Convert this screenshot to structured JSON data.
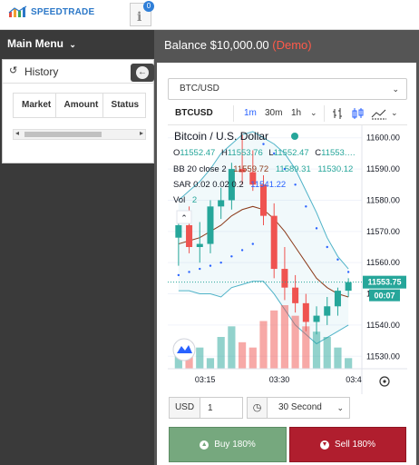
{
  "brand": {
    "name": "SPEEDTRADE"
  },
  "notifications": {
    "count": "0",
    "icon": "info-icon"
  },
  "sidebar": {
    "main_menu_label": "Main Menu",
    "history": {
      "title": "History",
      "columns": [
        "Market",
        "Amount",
        "Status"
      ]
    }
  },
  "account": {
    "balance_text": "Balance $10,000.00",
    "mode_text": "(Demo)"
  },
  "market_select": {
    "value": "BTC/USD"
  },
  "chart_toolbar": {
    "symbol": "BTCUSD",
    "timeframes": [
      "1m",
      "30m",
      "1h"
    ],
    "active_timeframe": "1m"
  },
  "chart_data": {
    "type": "candlestick",
    "title": "Bitcoin / U.S. Dollar",
    "ohlc_legend": {
      "o_label": "O",
      "o": "11552.47",
      "h_label": "H",
      "h": "11553.76",
      "l_label": "L",
      "l": "11552.47",
      "c_label": "C",
      "c": "11553.…"
    },
    "bb_legend": {
      "label": "BB 20 close 2",
      "basis": "11559.72",
      "upper": "11589.31",
      "lower": "11530.12"
    },
    "sar_legend": {
      "label": "SAR 0.02 0.02 0.2",
      "value": "11541.22"
    },
    "vol_legend": {
      "label": "Vol",
      "value": "2"
    },
    "y_ticks": [
      11600,
      11590,
      11580,
      11570,
      11560,
      11550,
      11540,
      11530
    ],
    "y_tick_labels": [
      "11600.00",
      "11590.00",
      "11580.00",
      "11570.00",
      "11560.00",
      "11550.00",
      "11540.00",
      "11530.00"
    ],
    "ylim": [
      11526,
      11604
    ],
    "x_tick_labels": [
      "03:15",
      "03:30",
      "03:4"
    ],
    "last_price": "11553.75",
    "countdown": "00:07",
    "colors": {
      "up": "#26a69a",
      "down": "#ef5350",
      "bb": "#4fb3c8",
      "basis": "#8b3a1a",
      "sar": "#2962ff"
    },
    "candles": [
      {
        "o": 11568,
        "h": 11575,
        "l": 11559,
        "c": 11572
      },
      {
        "o": 11572,
        "h": 11578,
        "l": 11563,
        "c": 11565
      },
      {
        "o": 11565,
        "h": 11573,
        "l": 11560,
        "c": 11566
      },
      {
        "o": 11566,
        "h": 11580,
        "l": 11563,
        "c": 11578
      },
      {
        "o": 11578,
        "h": 11584,
        "l": 11574,
        "c": 11580
      },
      {
        "o": 11580,
        "h": 11592,
        "l": 11577,
        "c": 11590
      },
      {
        "o": 11590,
        "h": 11601,
        "l": 11585,
        "c": 11589
      },
      {
        "o": 11589,
        "h": 11596,
        "l": 11583,
        "c": 11585
      },
      {
        "o": 11585,
        "h": 11588,
        "l": 11572,
        "c": 11575
      },
      {
        "o": 11575,
        "h": 11579,
        "l": 11555,
        "c": 11558
      },
      {
        "o": 11558,
        "h": 11565,
        "l": 11548,
        "c": 11552
      },
      {
        "o": 11552,
        "h": 11556,
        "l": 11544,
        "c": 11547
      },
      {
        "o": 11547,
        "h": 11550,
        "l": 11538,
        "c": 11541
      },
      {
        "o": 11541,
        "h": 11546,
        "l": 11537,
        "c": 11543
      },
      {
        "o": 11543,
        "h": 11549,
        "l": 11540,
        "c": 11546
      },
      {
        "o": 11546,
        "h": 11552,
        "l": 11543,
        "c": 11551
      },
      {
        "o": 11551,
        "h": 11555,
        "l": 11549,
        "c": 11553.75
      }
    ],
    "volume": [
      3,
      5,
      4,
      2,
      6,
      8,
      5,
      4,
      9,
      11,
      12,
      10,
      8,
      7,
      6,
      4,
      2
    ],
    "bb_upper": [
      11580,
      11583,
      11586,
      11590,
      11595,
      11598,
      11601,
      11602,
      11600,
      11598,
      11595,
      11590,
      11583,
      11576,
      11568,
      11562,
      11558
    ],
    "bb_basis": [
      11566,
      11567,
      11568,
      11570,
      11572,
      11575,
      11577,
      11578,
      11577,
      11574,
      11570,
      11565,
      11560,
      11555,
      11552,
      11550,
      11549
    ],
    "bb_lower": [
      11551,
      11551,
      11550,
      11550,
      11549,
      11552,
      11553,
      11554,
      11554,
      11550,
      11545,
      11540,
      11537,
      11534,
      11536,
      11538,
      11540
    ],
    "sar": [
      11556,
      11557,
      11558,
      11559,
      11560,
      11562,
      11564,
      11566,
      11598,
      11595,
      11590,
      11585,
      11578,
      11571,
      11565,
      11561,
      11557
    ]
  },
  "order_form": {
    "currency": "USD",
    "amount": "1",
    "expiry": "30 Second",
    "buy_label": "Buy 180%",
    "sell_label": "Sell 180%"
  }
}
